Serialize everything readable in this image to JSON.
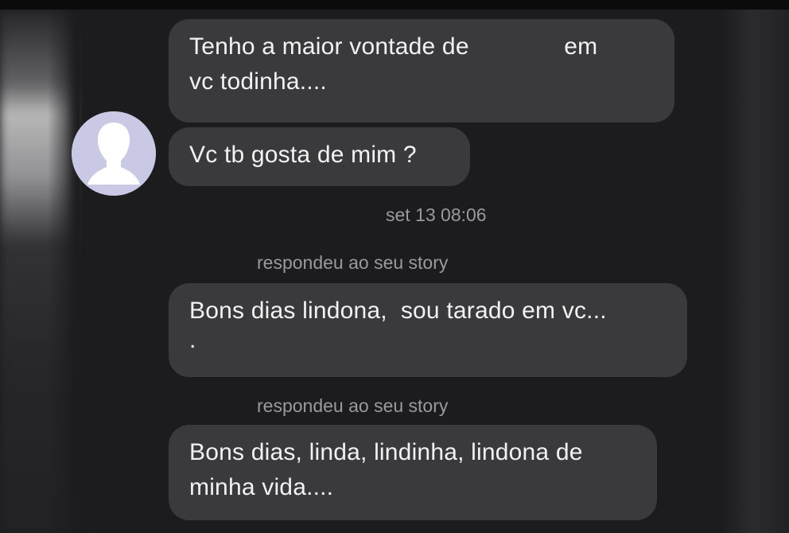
{
  "messages": [
    {
      "lines": [
        "Tenho a maior vontade de              em",
        "vc todinha...."
      ]
    },
    {
      "lines": [
        "Vc tb gosta de mim ?"
      ]
    },
    {
      "lines": [
        "Bons dias lindona,  sou tarado em vc...",
        "."
      ]
    },
    {
      "lines": [
        "Bons dias, linda, lindinha, lindona de",
        "minha vida...."
      ]
    }
  ],
  "timestamp": "set 13 08:06",
  "story_reply_label": "respondeu ao seu story",
  "colors": {
    "background": "#1c1c1e",
    "bubble": "#3a3a3c",
    "text": "#f2f2f2",
    "meta_text": "#9a9a9e",
    "avatar": "#c9c9e6"
  },
  "icons": {
    "avatar": "default-profile-silhouette-icon"
  }
}
